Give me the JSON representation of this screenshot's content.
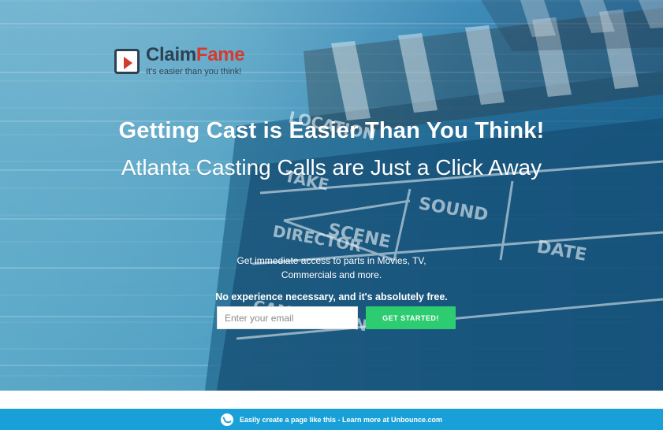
{
  "brand": {
    "name_part_1": "Claim",
    "name_part_2": "Fame",
    "tagline": "It's easier than you think!"
  },
  "hero": {
    "headline": "Getting Cast is Easier Than You Think!",
    "subheadline": "Atlanta Casting Calls are Just a Click Away",
    "description_line_1": "Get immediate access to parts in Movies, TV,",
    "description_line_2": "Commercials and more.",
    "strong_line": "No experience necessary, and it's absolutely free."
  },
  "form": {
    "email_placeholder": "Enter your email",
    "cta_label": "GET STARTED!"
  },
  "footer": {
    "text": "Easily create a page like this - Learn more at Unbounce.com"
  }
}
